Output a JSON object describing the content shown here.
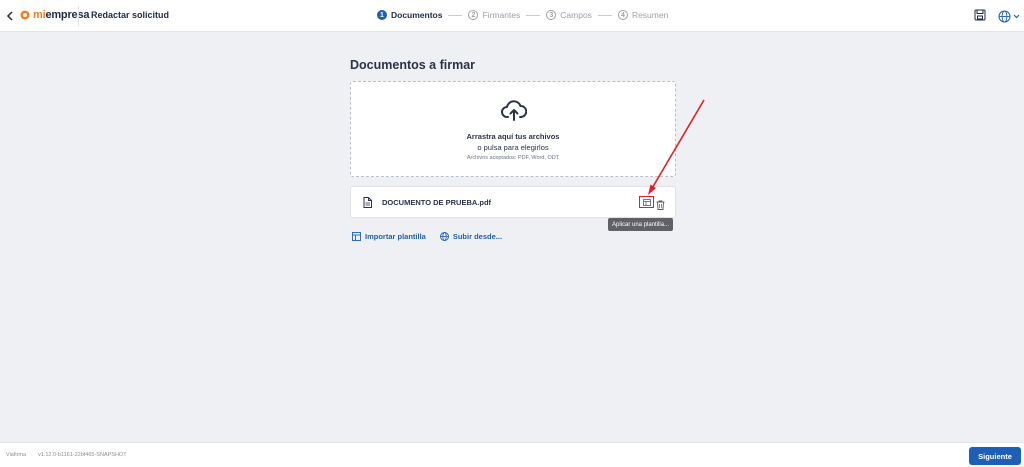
{
  "header": {
    "logo_prefix": "mi",
    "logo_suffix": "empresa",
    "page_title": "Redactar solicitud",
    "steps": [
      {
        "number": "1",
        "label": "Documentos",
        "active": true
      },
      {
        "number": "2",
        "label": "Firmantes",
        "active": false
      },
      {
        "number": "3",
        "label": "Campos",
        "active": false
      },
      {
        "number": "4",
        "label": "Resumen",
        "active": false
      }
    ]
  },
  "main": {
    "section_title": "Documentos a firmar",
    "dropzone": {
      "line1": "Arrastra aquí tus archivos",
      "line2": "o pulsa para elegirlos",
      "hint": "Archivos aceptados: PDF, Word, ODT"
    },
    "file": {
      "name": "DOCUMENTO DE PRUEBA.pdf",
      "tooltip": "Aplicar una plantilla..."
    },
    "actions": {
      "import_template": "Importar plantilla",
      "upload_from": "Subir desde..."
    }
  },
  "footer": {
    "brand": "Viafirma",
    "version": "v1.12.0-b1161-22bf465-SNAPSHOT",
    "next_label": "Siguiente"
  },
  "icons": {
    "back": "chevron-left-icon",
    "save": "save-icon",
    "language": "globe-icon",
    "upload": "cloud-upload-icon",
    "file": "document-icon",
    "template": "template-icon",
    "delete": "trash-icon"
  },
  "colors": {
    "primary": "#1d5fb6",
    "brand_orange": "#f47b20",
    "annotation_red": "#e31e24",
    "background": "#eff0f4"
  }
}
